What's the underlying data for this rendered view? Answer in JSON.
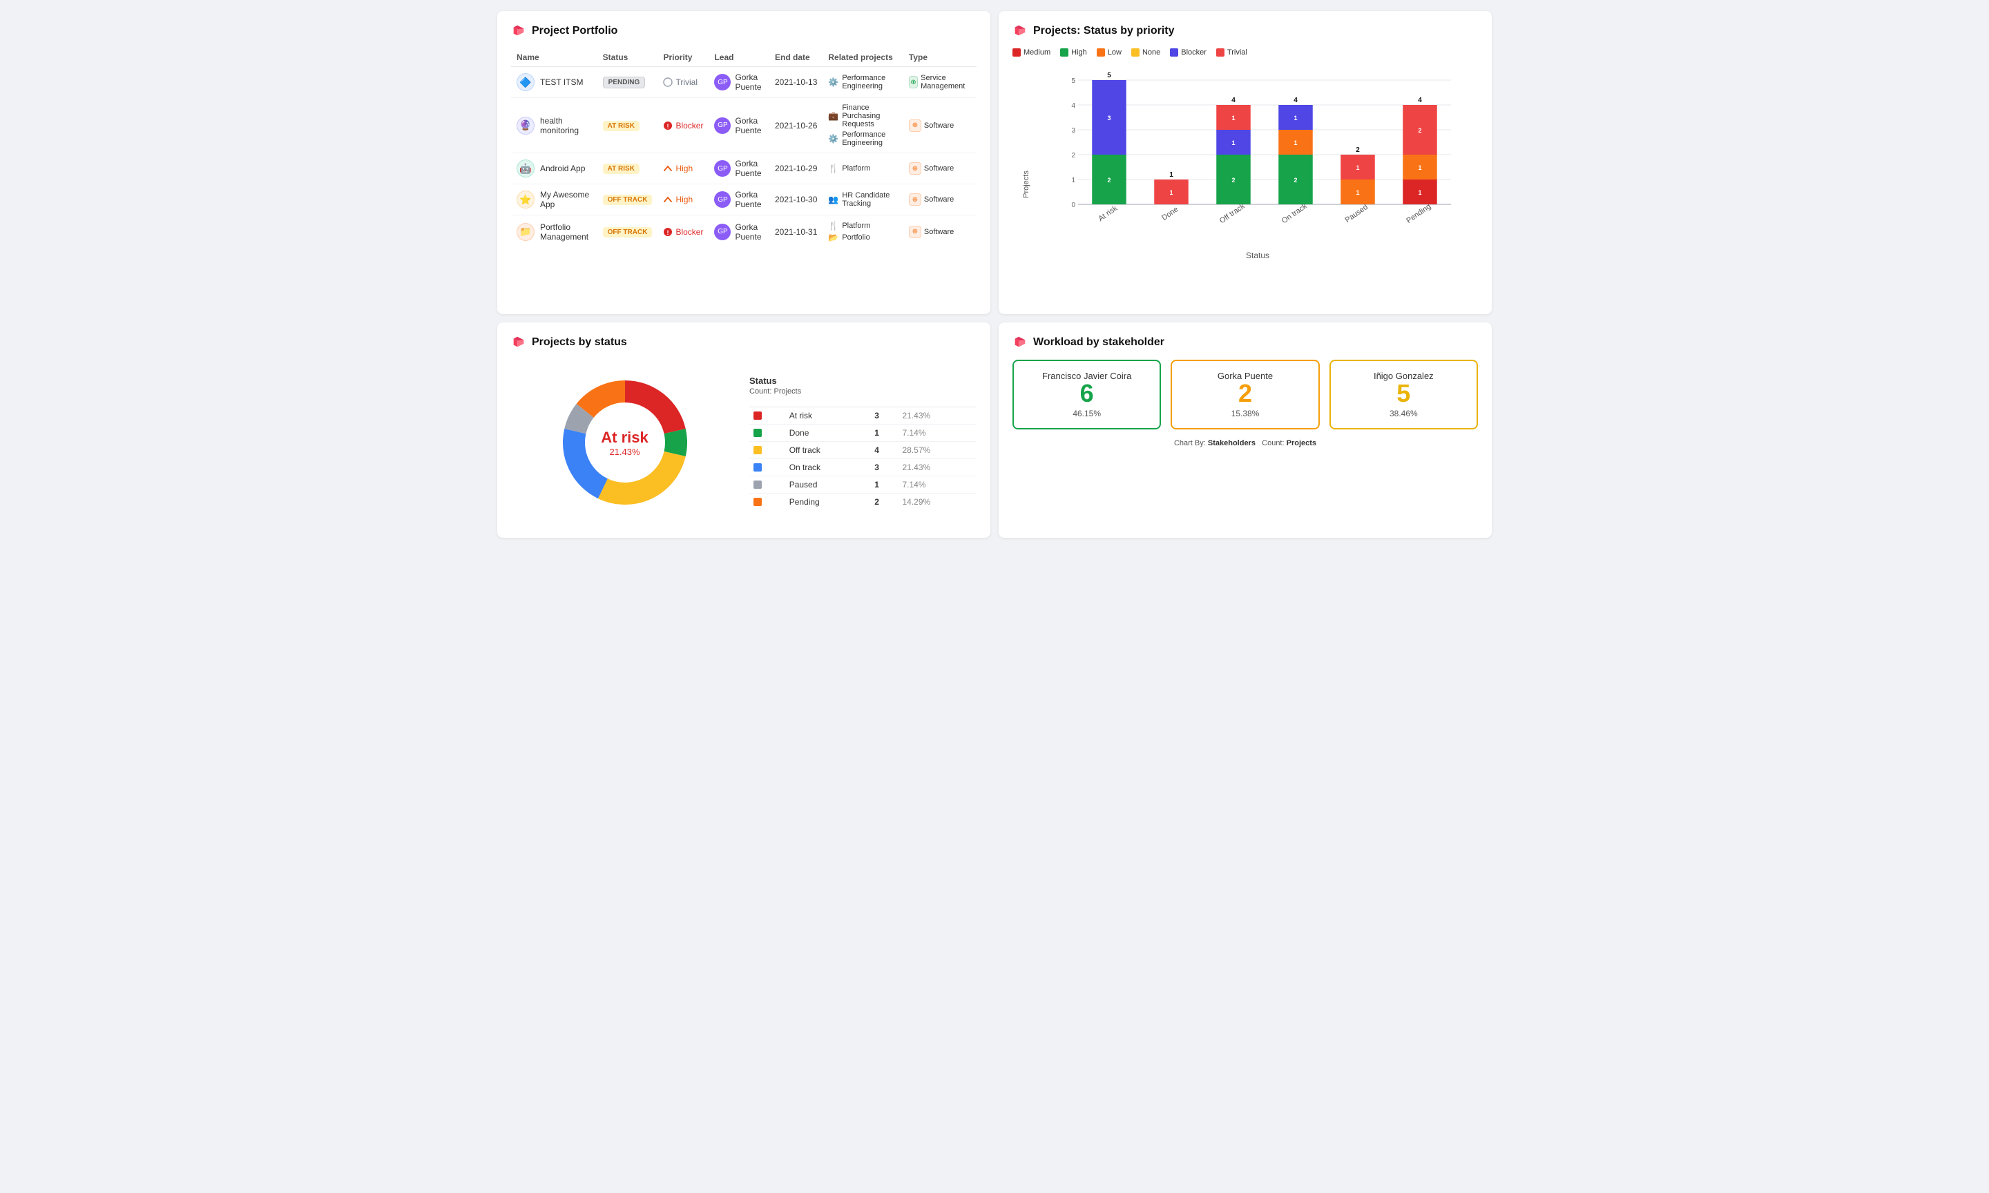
{
  "header": {
    "logo": "🏴"
  },
  "portfolio": {
    "title": "Project Portfolio",
    "columns": [
      "Name",
      "Status",
      "Priority",
      "Lead",
      "End date",
      "Related projects",
      "Type"
    ],
    "rows": [
      {
        "icon": "🔵",
        "iconBg": "#3b82f6",
        "name": "TEST ITSM",
        "status": "PENDING",
        "statusType": "pending",
        "priority": "Trivial",
        "priorityType": "trivial",
        "lead": "Gorka Puente",
        "endDate": "2021-10-13",
        "related": [
          "Performance Engineering"
        ],
        "type": "Service Management",
        "typeIcon": "🟢"
      },
      {
        "icon": "🔵",
        "iconBg": "#6366f1",
        "name": "health monitoring",
        "status": "AT RISK",
        "statusType": "at-risk",
        "priority": "Blocker",
        "priorityType": "blocker",
        "lead": "Gorka Puente",
        "endDate": "2021-10-26",
        "related": [
          "Finance Purchasing Requests",
          "Performance Engineering"
        ],
        "type": "Software",
        "typeIcon": "🟠"
      },
      {
        "icon": "🤖",
        "iconBg": "#10b981",
        "name": "Android App",
        "status": "AT RISK",
        "statusType": "at-risk",
        "priority": "High",
        "priorityType": "high",
        "lead": "Gorka Puente",
        "endDate": "2021-10-29",
        "related": [
          "Platform"
        ],
        "type": "Software",
        "typeIcon": "🟠"
      },
      {
        "icon": "⭐",
        "iconBg": "#f59e0b",
        "name": "My Awesome App",
        "status": "OFF TRACK",
        "statusType": "off-track",
        "priority": "High",
        "priorityType": "high",
        "lead": "Gorka Puente",
        "endDate": "2021-10-30",
        "related": [
          "HR Candidate Tracking"
        ],
        "type": "Software",
        "typeIcon": "🟠"
      },
      {
        "icon": "📁",
        "iconBg": "#f97316",
        "name": "Portfolio Management",
        "status": "OFF TRACK",
        "statusType": "off-track",
        "priority": "Blocker",
        "priorityType": "blocker",
        "lead": "Gorka Puente",
        "endDate": "2021-10-31",
        "related": [
          "Platform",
          "Portfolio"
        ],
        "type": "Software",
        "typeIcon": "🟠"
      }
    ]
  },
  "statusChart": {
    "title": "Projects: Status by priority",
    "legend": [
      {
        "label": "Medium",
        "color": "#dc2626"
      },
      {
        "label": "High",
        "color": "#16a34a"
      },
      {
        "label": "Low",
        "color": "#f97316"
      },
      {
        "label": "None",
        "color": "#fbbf24"
      },
      {
        "label": "Blocker",
        "color": "#4f46e5"
      },
      {
        "label": "Trivial",
        "color": "#ef4444"
      }
    ],
    "xAxis": [
      "At risk",
      "Done",
      "Off track",
      "On track",
      "Paused",
      "Pending"
    ],
    "yLabel": "Projects",
    "xLabel": "Status",
    "bars": {
      "At risk": {
        "Medium": 0,
        "High": 2,
        "Low": 0,
        "None": 0,
        "Blocker": 3,
        "Trivial": 0
      },
      "Done": {
        "Medium": 0,
        "High": 0,
        "Low": 0,
        "None": 0,
        "Blocker": 0,
        "Trivial": 1
      },
      "Off track": {
        "Medium": 0,
        "High": 2,
        "Low": 0,
        "None": 0,
        "Blocker": 1,
        "Trivial": 1
      },
      "On track": {
        "Medium": 0,
        "High": 2,
        "Low": 1,
        "None": 0,
        "Blocker": 1,
        "Trivial": 0
      },
      "Paused": {
        "Medium": 0,
        "High": 0,
        "Low": 1,
        "None": 0,
        "Blocker": 0,
        "Trivial": 1
      },
      "Pending": {
        "Medium": 1,
        "High": 0,
        "Low": 1,
        "None": 0,
        "Blocker": 0,
        "Trivial": 2
      }
    }
  },
  "donutChart": {
    "title": "Projects by status",
    "centerLabel": "At risk",
    "centerPct": "21.43%",
    "legendTitle": "Status",
    "countTitle": "Count:",
    "countLabel": "Projects",
    "items": [
      {
        "label": "At risk",
        "color": "#dc2626",
        "count": 3,
        "pct": "21.43%"
      },
      {
        "label": "Done",
        "color": "#16a34a",
        "count": 1,
        "pct": "7.14%"
      },
      {
        "label": "Off track",
        "color": "#fbbf24",
        "count": 4,
        "pct": "28.57%"
      },
      {
        "label": "On track",
        "color": "#3b82f6",
        "count": 3,
        "pct": "21.43%"
      },
      {
        "label": "Paused",
        "color": "#9ca3af",
        "count": 1,
        "pct": "7.14%"
      },
      {
        "label": "Pending",
        "color": "#f97316",
        "count": 2,
        "pct": "14.29%"
      }
    ]
  },
  "workload": {
    "title": "Workload by stakeholder",
    "stakeholders": [
      {
        "name": "Francisco Javier Coira",
        "count": 6,
        "pct": "46.15%",
        "colorClass": "wc-green"
      },
      {
        "name": "Gorka Puente",
        "count": 2,
        "pct": "15.38%",
        "colorClass": "wc-orange"
      },
      {
        "name": "Iñigo Gonzalez",
        "count": 5,
        "pct": "38.46%",
        "colorClass": "wc-yellow"
      }
    ],
    "chartBy": "Stakeholders",
    "countBy": "Projects"
  }
}
